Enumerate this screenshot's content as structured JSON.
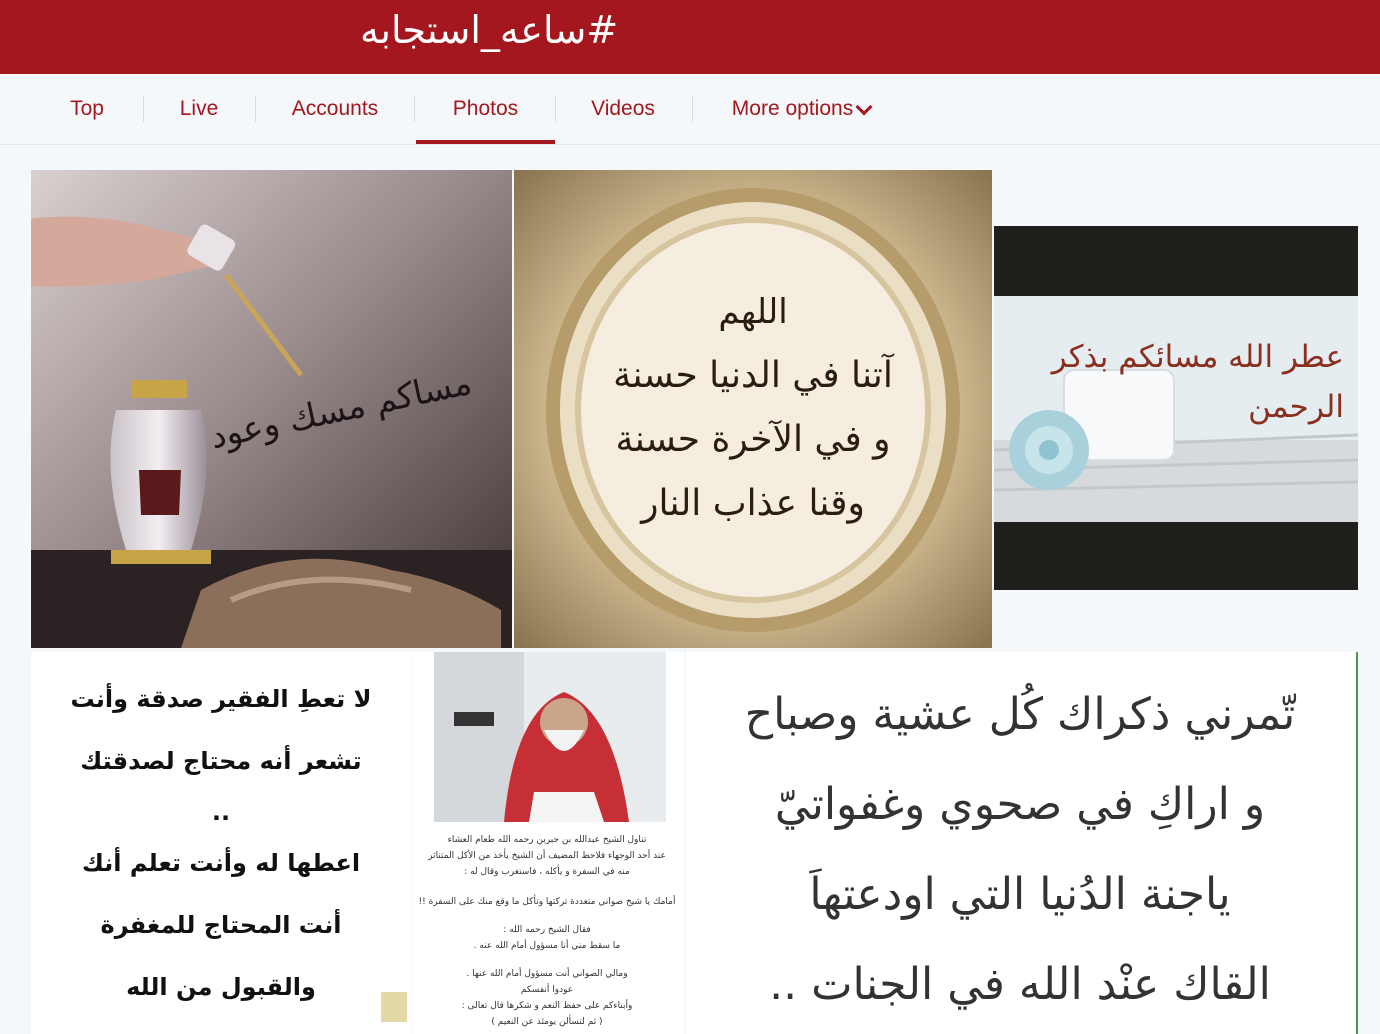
{
  "header": {
    "title": "#ساعه_استجابه",
    "bg_color": "#a5171e"
  },
  "tabs": [
    {
      "label": "Top"
    },
    {
      "label": "Live"
    },
    {
      "label": "Accounts"
    },
    {
      "label": "Photos",
      "active": true
    },
    {
      "label": "Videos"
    },
    {
      "label": "More options"
    }
  ],
  "photos": {
    "p1": {
      "text": "مساكم مسك وعود"
    },
    "p2": {
      "lines": [
        "اللهم",
        "آتنا في الدنيا حسنة",
        "و في الآخرة حسنة",
        "وقنا عذاب النار"
      ]
    },
    "p3": {
      "lines": [
        "عطر الله مسائكم بذكر",
        "الرحمن"
      ]
    },
    "p4": {
      "lines": [
        "لا تعطِ الفقير صدقة وأنت",
        "تشعر أنه محتاج لصدقتك",
        "..",
        "اعطها له وأنت تعلم أنك",
        "أنت المحتاج للمغفرة",
        "والقبول من الله"
      ]
    },
    "p5": {
      "lines": [
        "تناول الشيخ عبدالله بن جبرين رحمه الله طعام العشاء",
        "عند أحد الوجهاء فلاحظ المضيف أن الشيخ يأخذ من الأكل المتناثر",
        "منه في السفرة و يأكله ، فاستغرب وقال له :",
        "أمامك يا شيخ صواني متعددة تركتها وتأكل ما وقع منك على السفرة !!",
        "فقال الشيخ رحمه الله :",
        "ما سقط مني أنا مسؤول أمام الله عنه .",
        "ومالي الصواني أنت مسؤول أمام الله عنها .",
        "عودوا أنفسكم",
        "وأبناءكم على حفظ النعم و شكرها قال تعالى :",
        "( ثم لتسألن يومئذ عن النعيم )"
      ]
    },
    "p6": {
      "lines": [
        "تّمرني ذكراك كُل عشية وصباح",
        "و اراكِ في صحوي وغفواتيّ",
        "ياجنة الدُنيا التي اودعتهاَ",
        "القاك عنْد الله في الجنات .."
      ]
    }
  }
}
